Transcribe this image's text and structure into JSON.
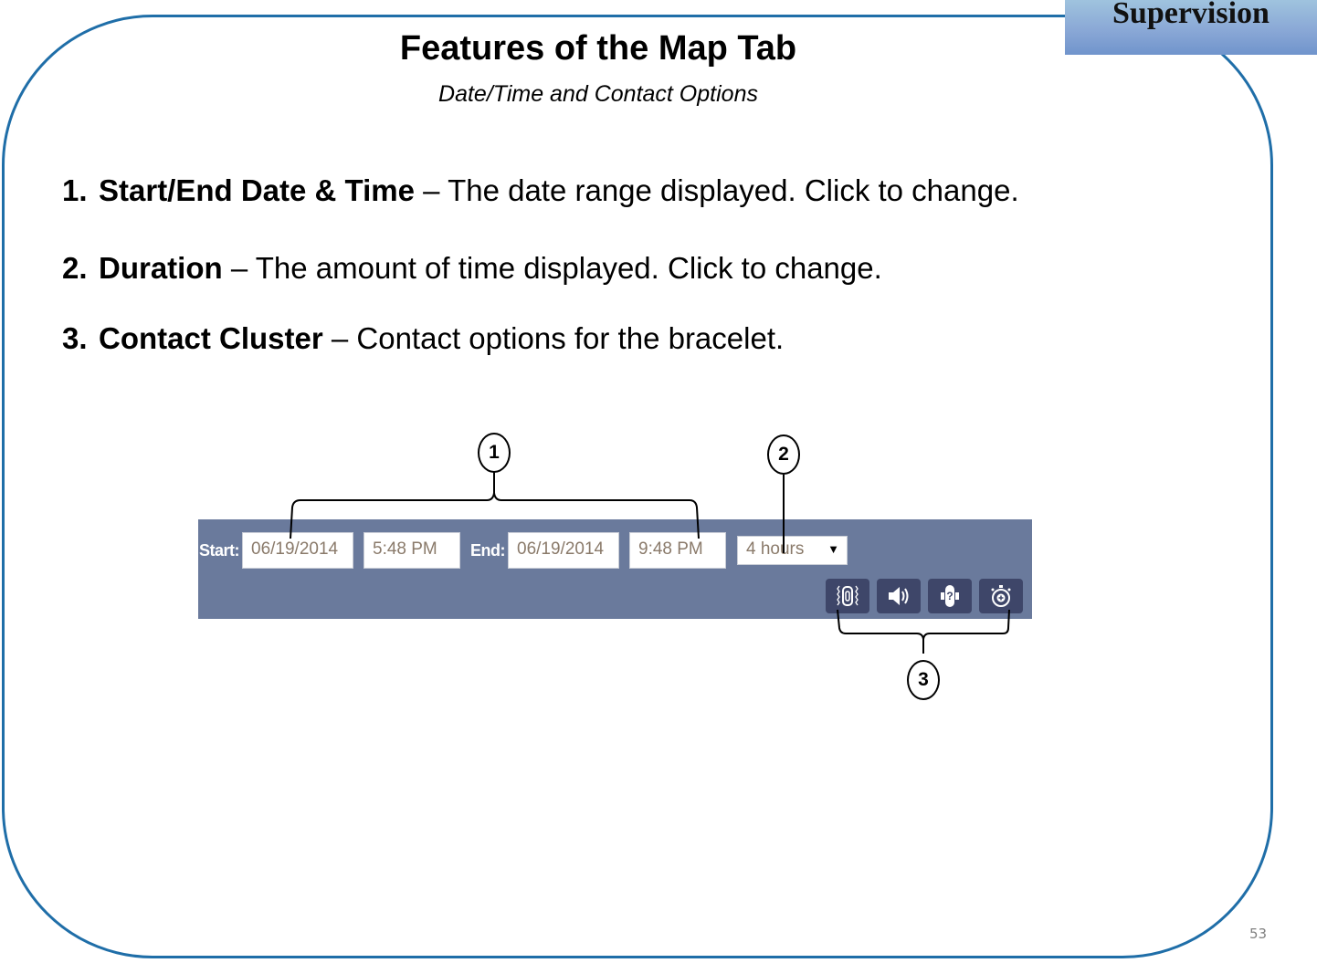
{
  "slide": {
    "badge": "Supervision",
    "title": "Features of the Map Tab",
    "subtitle": "Date/Time and Contact Options",
    "page_number": "53",
    "colors": {
      "frame": "#1f6ea8",
      "toolbar_bg": "#6a7a9c",
      "contact_button_bg": "#3e4669"
    }
  },
  "items": [
    {
      "number": "1.",
      "term": "Start/End Date & Time",
      "description": " – The date range displayed. Click to change."
    },
    {
      "number": "2.",
      "term": "Duration",
      "description": " – The amount of time displayed. Click to change."
    },
    {
      "number": "3.",
      "term": "Contact Cluster",
      "description": " – Contact options for the bracelet."
    }
  ],
  "toolbar": {
    "start_label": "Start:",
    "start_date": "06/19/2014",
    "start_time": "5:48 PM",
    "end_label": "End:",
    "end_date": "06/19/2014",
    "end_time": "9:48 PM",
    "duration": "4 hours",
    "dropdown_arrow": "▼",
    "contact_buttons": [
      {
        "icon": "vibrate-bracelet-icon"
      },
      {
        "icon": "speaker-sound-icon"
      },
      {
        "icon": "locate-bracelet-icon"
      },
      {
        "icon": "stopwatch-add-icon"
      }
    ]
  },
  "callouts": [
    "1",
    "2",
    "3"
  ]
}
